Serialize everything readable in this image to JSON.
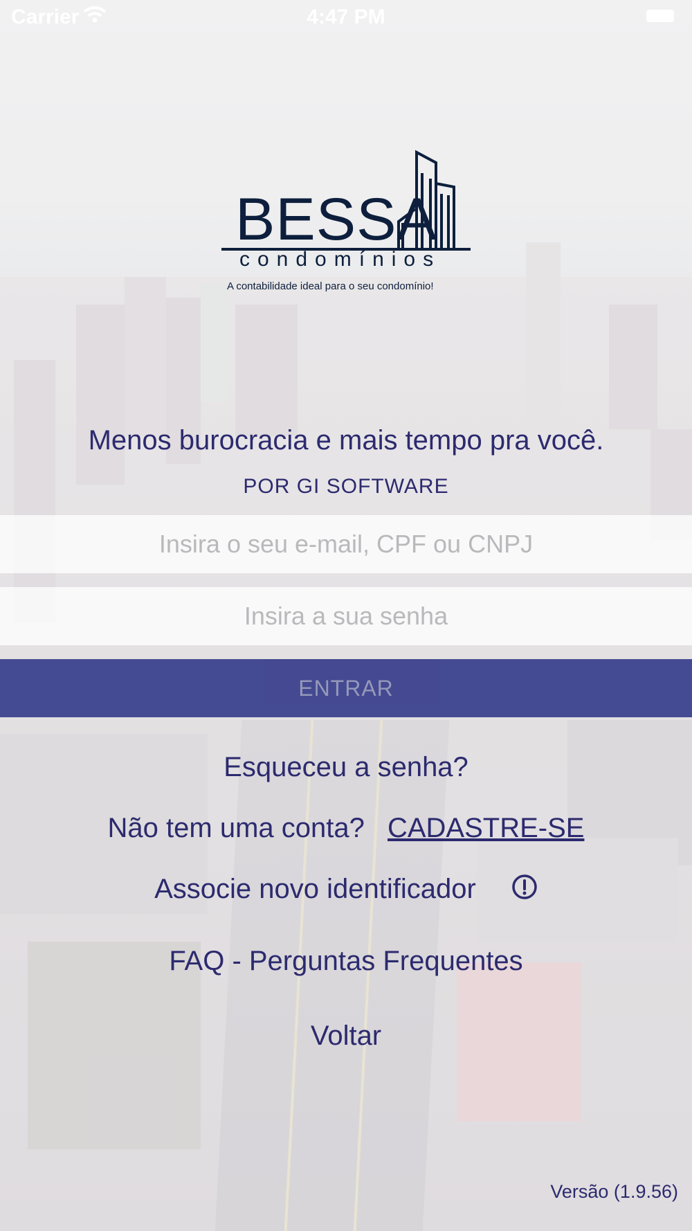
{
  "status_bar": {
    "carrier": "Carrier",
    "time": "4:47 PM"
  },
  "logo": {
    "wordmark": "BESSA",
    "subword": "condomínios",
    "tagline": "A contabilidade ideal para o seu condomínio!"
  },
  "slogan": "Menos burocracia e mais tempo pra você.",
  "byline": "POR GI SOFTWARE",
  "login_form": {
    "email_placeholder": "Insira o seu e-mail, CPF ou CNPJ",
    "email_value": "",
    "password_placeholder": "Insira a sua senha",
    "password_value": "",
    "submit_label": "ENTRAR"
  },
  "links": {
    "forgot_password": "Esqueceu a senha?",
    "signup_question": "Não tem uma conta?",
    "signup_link": "CADASTRE-SE",
    "associate_identifier": "Associe novo identificador",
    "faq": "FAQ - Perguntas Frequentes",
    "back": "Voltar"
  },
  "version": "Versão (1.9.56)",
  "colors": {
    "brand_navy": "#2c2a6e",
    "button_bg": "#2e3587",
    "logo_navy": "#0d1f3c"
  },
  "icons": {
    "wifi": "wifi-icon",
    "battery": "battery-icon",
    "logo_building": "building-icon",
    "info": "info-icon"
  }
}
